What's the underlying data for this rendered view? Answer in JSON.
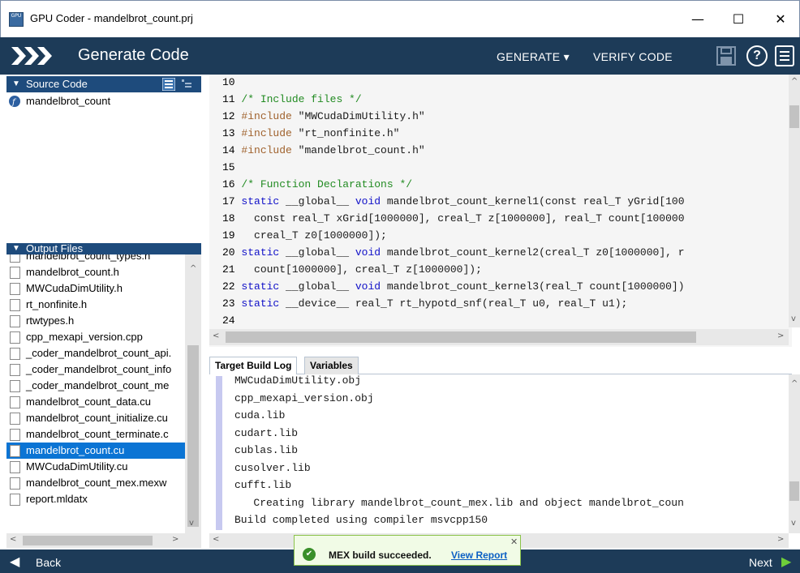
{
  "window": {
    "title": "GPU Coder - mandelbrot_count.prj",
    "app_icon_text": "GPU",
    "minimize": "—",
    "maximize": "☐",
    "close": "✕"
  },
  "toolbar": {
    "heading": "Generate Code",
    "generate_label": "GENERATE ▾",
    "verify_label": "VERIFY CODE",
    "help_label": "?"
  },
  "source_panel": {
    "header": "Source Code",
    "items": [
      "mandelbrot_count"
    ]
  },
  "output_panel": {
    "header": "Output Files",
    "items": [
      "mandelbrot_count_types.h",
      "mandelbrot_count.h",
      "MWCudaDimUtility.h",
      "rt_nonfinite.h",
      "rtwtypes.h",
      "cpp_mexapi_version.cpp",
      "_coder_mandelbrot_count_api.",
      "_coder_mandelbrot_count_info",
      "_coder_mandelbrot_count_me",
      "mandelbrot_count_data.cu",
      "mandelbrot_count_initialize.cu",
      "mandelbrot_count_terminate.c",
      "mandelbrot_count.cu",
      "MWCudaDimUtility.cu",
      "mandelbrot_count_mex.mexw",
      "report.mldatx"
    ],
    "selected_index": 12
  },
  "editor": {
    "lines": [
      {
        "n": "10",
        "parts": []
      },
      {
        "n": "11",
        "parts": [
          {
            "c": "cm",
            "t": "/* Include files */"
          }
        ]
      },
      {
        "n": "12",
        "parts": [
          {
            "c": "pp",
            "t": "#include"
          },
          {
            "c": "",
            "t": " \"MWCudaDimUtility.h\""
          }
        ]
      },
      {
        "n": "13",
        "parts": [
          {
            "c": "pp",
            "t": "#include"
          },
          {
            "c": "",
            "t": " \"rt_nonfinite.h\""
          }
        ]
      },
      {
        "n": "14",
        "parts": [
          {
            "c": "pp",
            "t": "#include"
          },
          {
            "c": "",
            "t": " \"mandelbrot_count.h\""
          }
        ]
      },
      {
        "n": "15",
        "parts": []
      },
      {
        "n": "16",
        "parts": [
          {
            "c": "cm",
            "t": "/* Function Declarations */"
          }
        ]
      },
      {
        "n": "17",
        "parts": [
          {
            "c": "kw",
            "t": "static"
          },
          {
            "c": "",
            "t": " __global__ "
          },
          {
            "c": "kw",
            "t": "void"
          },
          {
            "c": "",
            "t": " mandelbrot_count_kernel1(const real_T yGrid[100"
          }
        ]
      },
      {
        "n": "18",
        "parts": [
          {
            "c": "",
            "t": "  const real_T xGrid[1000000], creal_T z[1000000], real_T count[100000"
          }
        ]
      },
      {
        "n": "19",
        "parts": [
          {
            "c": "",
            "t": "  creal_T z0[1000000]);"
          }
        ]
      },
      {
        "n": "20",
        "parts": [
          {
            "c": "kw",
            "t": "static"
          },
          {
            "c": "",
            "t": " __global__ "
          },
          {
            "c": "kw",
            "t": "void"
          },
          {
            "c": "",
            "t": " mandelbrot_count_kernel2(creal_T z0[1000000], r"
          }
        ]
      },
      {
        "n": "21",
        "parts": [
          {
            "c": "",
            "t": "  count[1000000], creal_T z[1000000]);"
          }
        ]
      },
      {
        "n": "22",
        "parts": [
          {
            "c": "kw",
            "t": "static"
          },
          {
            "c": "",
            "t": " __global__ "
          },
          {
            "c": "kw",
            "t": "void"
          },
          {
            "c": "",
            "t": " mandelbrot_count_kernel3(real_T count[1000000])"
          }
        ]
      },
      {
        "n": "23",
        "parts": [
          {
            "c": "kw",
            "t": "static"
          },
          {
            "c": "",
            "t": " __device__ real_T rt_hypotd_snf(real_T u0, real_T u1);"
          }
        ]
      },
      {
        "n": "24",
        "parts": []
      }
    ]
  },
  "log_tabs": [
    "Target Build Log",
    "Variables"
  ],
  "build_log": [
    "MWCudaDimUtility.obj",
    "cpp_mexapi_version.obj",
    "cuda.lib",
    "cudart.lib",
    "cublas.lib",
    "cusolver.lib",
    "cufft.lib",
    "   Creating library mandelbrot_count_mex.lib and object mandelbrot_coun",
    "Build completed using compiler msvcpp150"
  ],
  "toast": {
    "message": "MEX build succeeded.",
    "link": "View Report",
    "close": "✕"
  },
  "footer": {
    "back_label": "Back",
    "next_label": "Next"
  }
}
